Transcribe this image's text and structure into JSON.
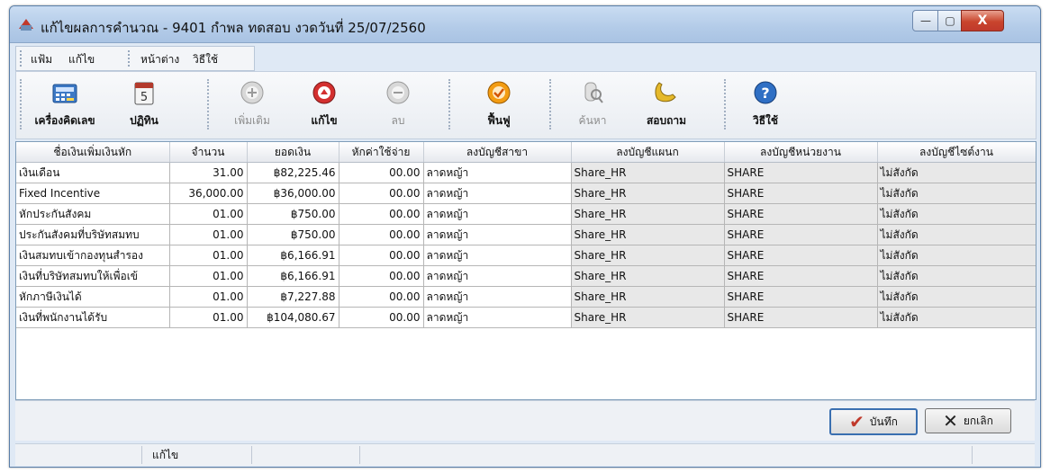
{
  "window": {
    "title": "แก้ไขผลการคำนวณ - 9401  กำพล ทดสอบ  งวดวันที่ 25/07/2560",
    "controls": [
      "—",
      "▢",
      "X"
    ]
  },
  "menu": [
    "แฟ้ม",
    "แก้ไข",
    "หน้าต่าง",
    "วิธีใช้"
  ],
  "toolbar": [
    {
      "label": "เครื่องคิดเลข",
      "icon": "calculator-icon",
      "enabled": true
    },
    {
      "label": "ปฏิทิน",
      "icon": "calendar-icon",
      "enabled": true
    },
    {
      "label": "เพิ่มเติม",
      "icon": "add-icon",
      "enabled": false
    },
    {
      "label": "แก้ไข",
      "icon": "edit-icon",
      "enabled": true
    },
    {
      "label": "ลบ",
      "icon": "delete-icon",
      "enabled": false
    },
    {
      "label": "ฟื้นฟู",
      "icon": "refresh-icon",
      "enabled": true
    },
    {
      "label": "ค้นหา",
      "icon": "search-icon",
      "enabled": false
    },
    {
      "label": "สอบถาม",
      "icon": "phone-icon",
      "enabled": true
    },
    {
      "label": "วิธีใช้",
      "icon": "help-icon",
      "enabled": true
    }
  ],
  "table": {
    "columns": [
      "ชื่อเงินเพิ่มเงินหัก",
      "จำนวน",
      "ยอดเงิน",
      "หักค่าใช้จ่าย",
      "ลงบัญชีสาขา",
      "ลงบัญชีแผนก",
      "ลงบัญชีหน่วยงาน",
      "ลงบัญชีไซต์งาน"
    ],
    "rows": [
      [
        "เงินเดือน",
        "31.00",
        "฿82,225.46",
        "00.00",
        "ลาดหญ้า",
        "Share_HR",
        "SHARE",
        "ไม่สังกัด"
      ],
      [
        "Fixed Incentive",
        "36,000.00",
        "฿36,000.00",
        "00.00",
        "ลาดหญ้า",
        "Share_HR",
        "SHARE",
        "ไม่สังกัด"
      ],
      [
        "หักประกันสังคม",
        "01.00",
        "฿750.00",
        "00.00",
        "ลาดหญ้า",
        "Share_HR",
        "SHARE",
        "ไม่สังกัด"
      ],
      [
        "ประกันสังคมที่บริษัทสมทบ",
        "01.00",
        "฿750.00",
        "00.00",
        "ลาดหญ้า",
        "Share_HR",
        "SHARE",
        "ไม่สังกัด"
      ],
      [
        "เงินสมทบเข้ากองทุนสำรอง",
        "01.00",
        "฿6,166.91",
        "00.00",
        "ลาดหญ้า",
        "Share_HR",
        "SHARE",
        "ไม่สังกัด"
      ],
      [
        "เงินที่บริษัทสมทบให้เพื่อเข้",
        "01.00",
        "฿6,166.91",
        "00.00",
        "ลาดหญ้า",
        "Share_HR",
        "SHARE",
        "ไม่สังกัด"
      ],
      [
        "หักภาษีเงินได้",
        "01.00",
        "฿7,227.88",
        "00.00",
        "ลาดหญ้า",
        "Share_HR",
        "SHARE",
        "ไม่สังกัด"
      ],
      [
        "เงินที่พนักงานได้รับ",
        "01.00",
        "฿104,080.67",
        "00.00",
        "ลาดหญ้า",
        "Share_HR",
        "SHARE",
        "ไม่สังกัด"
      ]
    ]
  },
  "buttons": {
    "save": "บันทึก",
    "cancel": "ยกเลิก"
  },
  "status": {
    "mode": "แก้ไข"
  },
  "colors": {
    "accent": "#3a6fb0",
    "grid_border": "#7f9db9"
  }
}
